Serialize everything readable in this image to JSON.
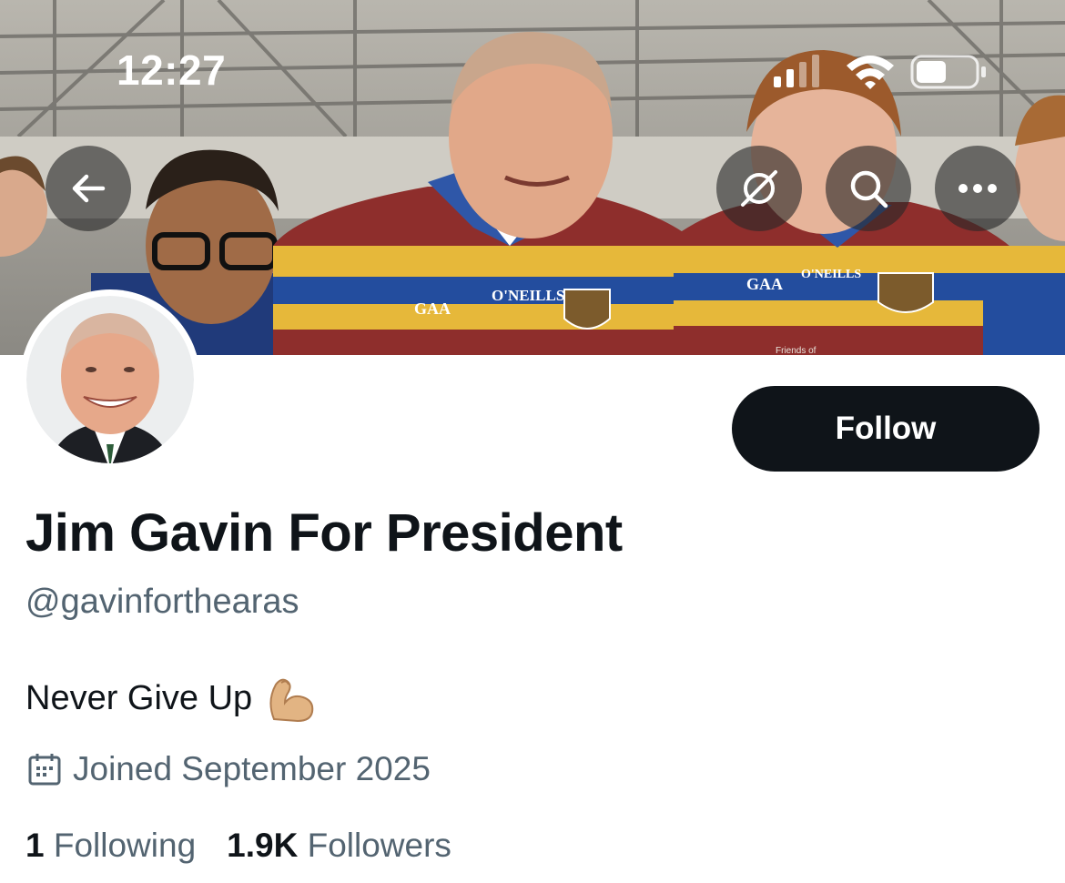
{
  "status_bar": {
    "time": "12:27"
  },
  "header": {
    "back_icon": "arrow-left-icon",
    "grok_icon": "grok-icon",
    "search_icon": "search-icon",
    "more_icon": "more-horizontal-icon"
  },
  "banner": {
    "jersey_text_1": "O'NEILLS",
    "jersey_logo_1": "GAA",
    "jersey_text_2": "O'NEILLS",
    "jersey_logo_2": "GAA",
    "shirt_sponsor": "Friends of"
  },
  "profile": {
    "display_name": "Jim Gavin For President",
    "handle": "@gavinforthearas",
    "bio": "Never Give Up",
    "bio_emoji": "flexed-biceps-icon",
    "joined": "Joined September 2025",
    "following_count": "1",
    "following_label": "Following",
    "followers_count": "1.9K",
    "followers_label": "Followers"
  },
  "actions": {
    "follow_label": "Follow"
  },
  "colors": {
    "text": "#0f1419",
    "secondary": "#536471",
    "button": "#0f1419"
  }
}
